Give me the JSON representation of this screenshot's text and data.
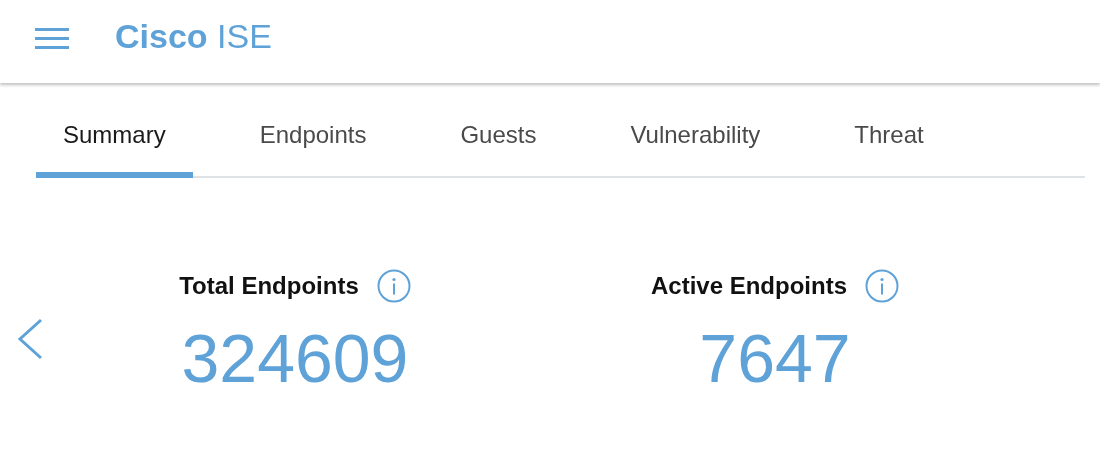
{
  "header": {
    "brand": "Cisco",
    "product": "ISE"
  },
  "tabs": [
    {
      "label": "Summary",
      "selected": true
    },
    {
      "label": "Endpoints",
      "selected": false
    },
    {
      "label": "Guests",
      "selected": false
    },
    {
      "label": "Vulnerability",
      "selected": false
    },
    {
      "label": "Threat",
      "selected": false
    }
  ],
  "stats": [
    {
      "label": "Total Endpoints",
      "value": "324609"
    },
    {
      "label": "Active Endpoints",
      "value": "7647"
    }
  ]
}
